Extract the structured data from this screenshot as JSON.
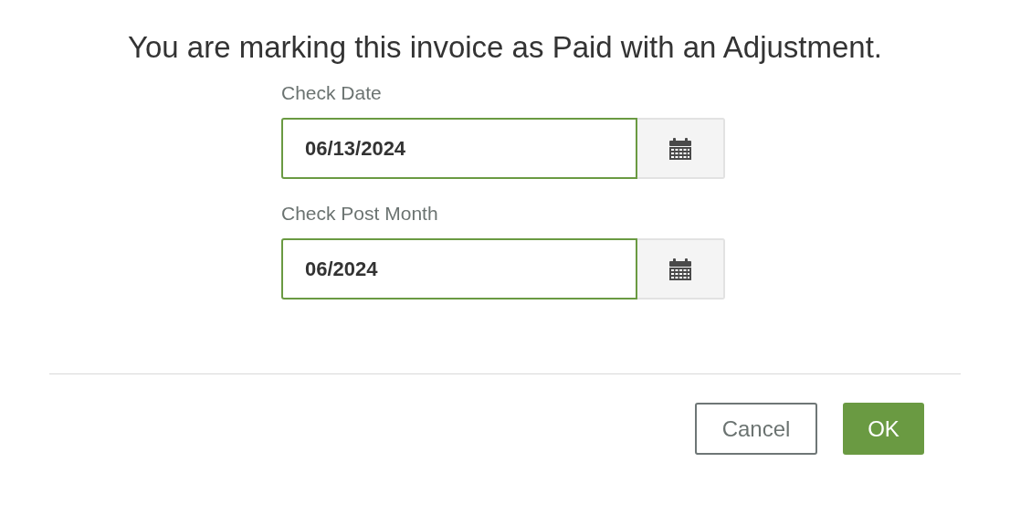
{
  "heading": "You are marking this invoice as Paid with an Adjustment.",
  "fields": [
    {
      "label": "Check Date",
      "value": "06/13/2024"
    },
    {
      "label": "Check Post Month",
      "value": "06/2024"
    }
  ],
  "buttons": [
    {
      "label": "Cancel",
      "kind": "secondary"
    },
    {
      "label": "OK",
      "kind": "primary"
    }
  ]
}
